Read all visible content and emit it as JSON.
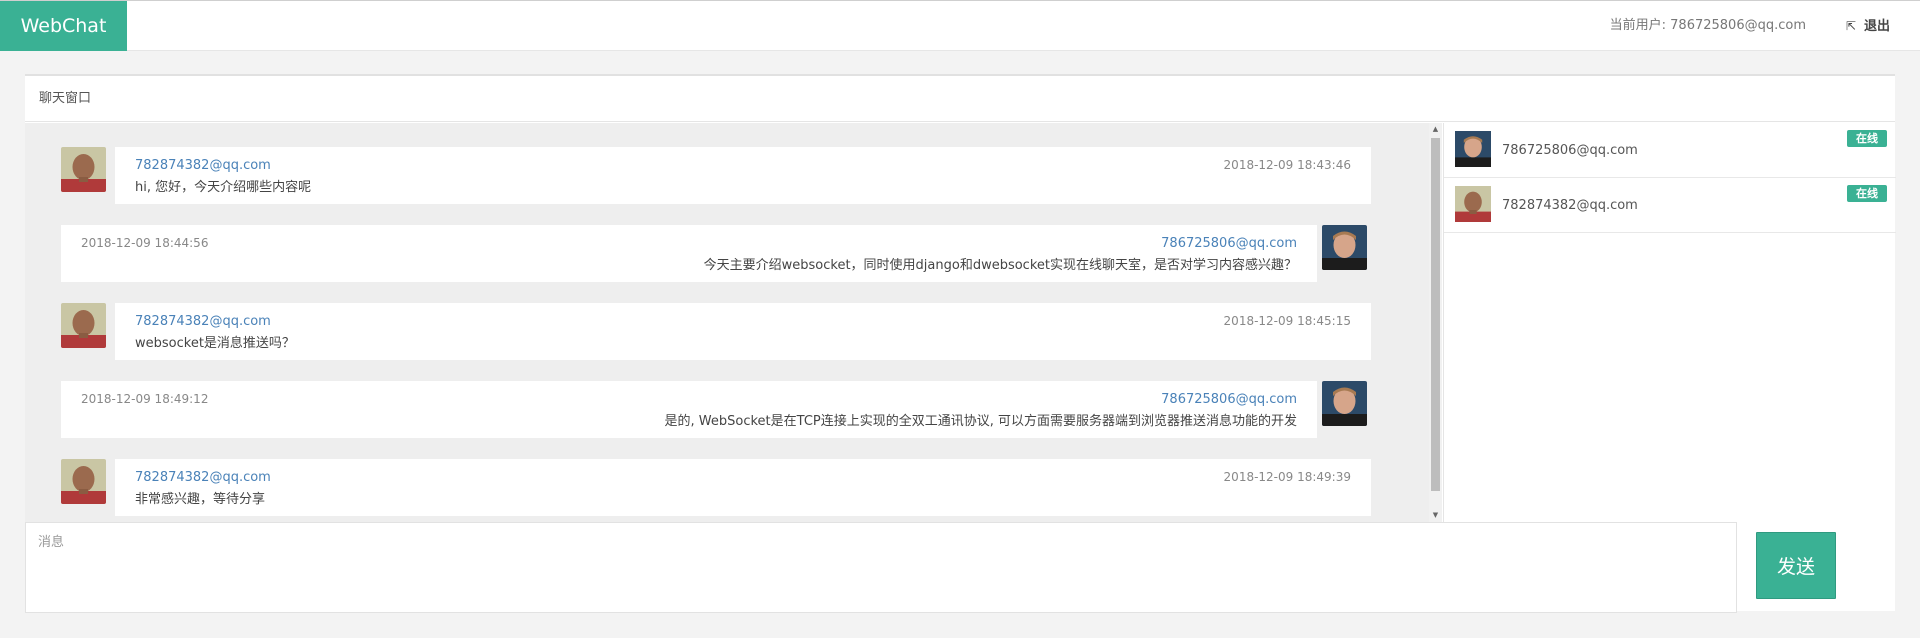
{
  "navbar": {
    "brand": "WebChat",
    "current_user": "当前用户: 786725806@qq.com",
    "logout_label": "退出",
    "logout_icon": "sign-out-icon"
  },
  "panel": {
    "title": "聊天窗口"
  },
  "messages": [
    {
      "side": "left",
      "sender": "782874382@qq.com",
      "time": "2018-12-09 18:43:46",
      "text": "hi, 您好，今天介绍哪些内容呢"
    },
    {
      "side": "right",
      "sender": "786725806@qq.com",
      "time": "2018-12-09 18:44:56",
      "text": "今天主要介绍websocket，同时使用django和dwebsocket实现在线聊天室，是否对学习内容感兴趣？"
    },
    {
      "side": "left",
      "sender": "782874382@qq.com",
      "time": "2018-12-09 18:45:15",
      "text": "websocket是消息推送吗？"
    },
    {
      "side": "right",
      "sender": "786725806@qq.com",
      "time": "2018-12-09 18:49:12",
      "text": "是的, WebSocket是在TCP连接上实现的全双工通讯协议, 可以方面需要服务器端到浏览器推送消息功能的开发"
    },
    {
      "side": "left",
      "sender": "782874382@qq.com",
      "time": "2018-12-09 18:49:39",
      "text": "非常感兴趣，等待分享"
    }
  ],
  "users": [
    {
      "email": "786725806@qq.com",
      "status": "在线"
    },
    {
      "email": "782874382@qq.com",
      "status": "在线"
    }
  ],
  "composer": {
    "placeholder": "消息",
    "send_label": "发送"
  },
  "colors": {
    "accent": "#3ab194",
    "link": "#4a82b8",
    "background": "#f3f3f3"
  }
}
